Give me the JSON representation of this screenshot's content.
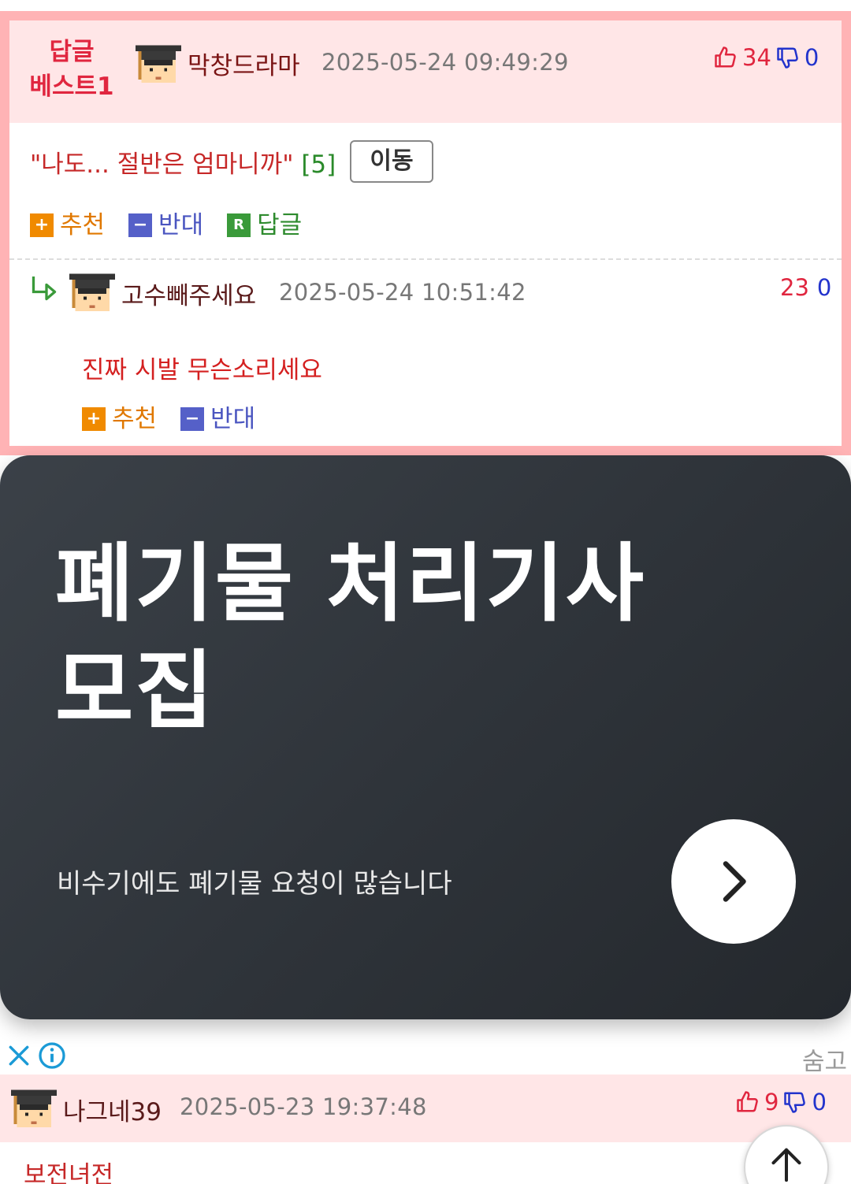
{
  "best_reply": {
    "badge_line1": "답글",
    "badge_line2": "베스트1",
    "author": "막창드라마",
    "date": "2025-05-24 09:49:29",
    "up_count": "34",
    "down_count": "0",
    "title": "\"나도... 절반은 엄마니까\"",
    "comment_count": "[5]",
    "move_label": "이동",
    "actions": {
      "recommend": "추천",
      "oppose": "반대",
      "reply": "답글",
      "reply_icon_letter": "R"
    }
  },
  "sub_reply": {
    "author": "고수빼주세요",
    "date": "2025-05-24 10:51:42",
    "up_count": "23",
    "down_count": "0",
    "body": "진짜 시발 무슨소리세요",
    "actions": {
      "recommend": "추천",
      "oppose": "반대"
    }
  },
  "ad": {
    "headline_line1": "폐기물 처리기사",
    "headline_line2": "모집",
    "subtext": "비수기에도 폐기물 요청이 많습니다",
    "hide_label": "숨고"
  },
  "next_comment": {
    "author": "나그네39",
    "date": "2025-05-23 19:37:48",
    "up_count": "9",
    "down_count": "0",
    "body": "보전녀전"
  },
  "colors": {
    "best_border": "#ffb3b5",
    "header_bg": "#ffe6e7",
    "accent_red": "#e0263f",
    "accent_blue": "#2233cc",
    "ad_bg": "#2e3339"
  }
}
